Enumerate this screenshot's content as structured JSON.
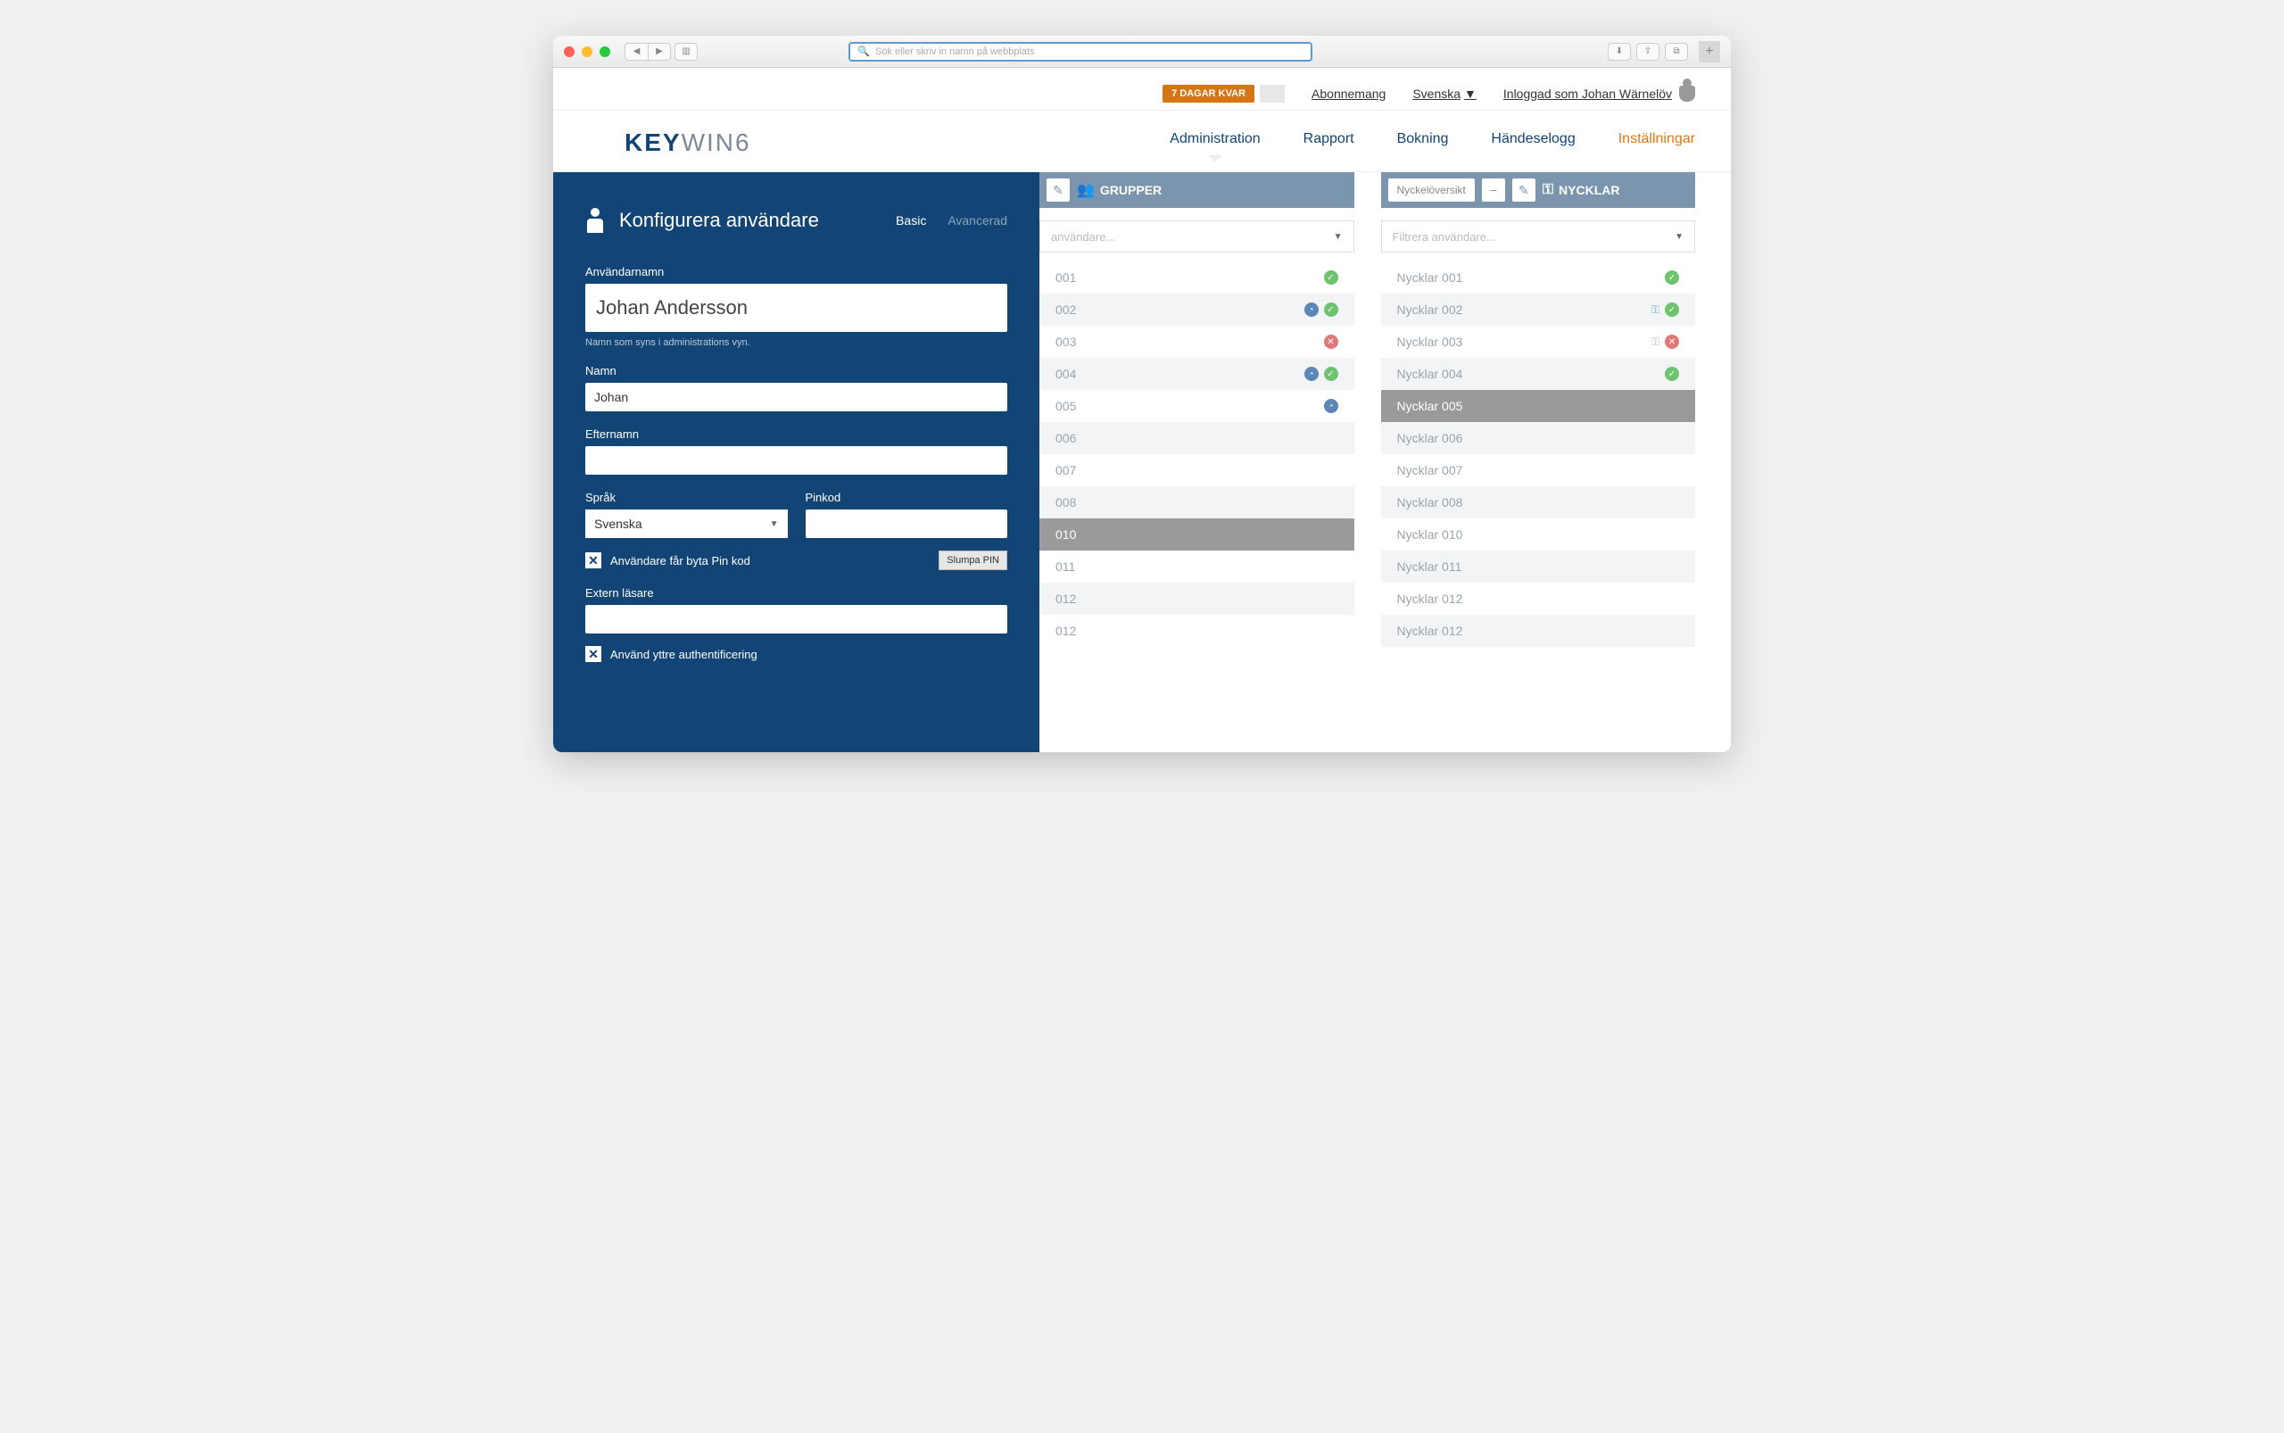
{
  "browser": {
    "placeholder": "Sök eller skriv in namn på webbplats"
  },
  "topstrip": {
    "trial": "7 DAGAR KVAR",
    "subscription": "Abonnemang",
    "language": "Svenska",
    "loggedin": "Inloggad som Johan Wärnelöv"
  },
  "logo": {
    "part1": "KEY",
    "part2": "WIN6"
  },
  "nav": {
    "items": [
      "Administration",
      "Rapport",
      "Bokning",
      "Händeselogg",
      "Inställningar"
    ]
  },
  "drawer": {
    "title": "Konfigurera användare",
    "tab_basic": "Basic",
    "tab_adv": "Avancerad",
    "labels": {
      "username": "Användarnamn",
      "username_hint": "Namn som syns i administrations vyn.",
      "firstname": "Namn",
      "lastname": "Efternamn",
      "language": "Språk",
      "pin": "Pinkod",
      "chk_pin": "Användare får byta Pin kod",
      "slump": "Slumpa PIN",
      "extreader": "Extern läsare",
      "chk_ext": "Använd yttre authentificering"
    },
    "values": {
      "username": "Johan Andersson",
      "firstname": "Johan",
      "lastname": "",
      "language": "Svenska",
      "pin": "",
      "extreader": ""
    }
  },
  "columns": {
    "groups": {
      "title": "GRUPPER",
      "filter": "användare...",
      "rows": [
        {
          "label": "001",
          "icons": [
            "green"
          ],
          "alt": false
        },
        {
          "label": "002",
          "icons": [
            "clock",
            "green"
          ],
          "alt": true
        },
        {
          "label": "003",
          "icons": [
            "red"
          ],
          "alt": false
        },
        {
          "label": "004",
          "icons": [
            "clock",
            "green"
          ],
          "alt": true
        },
        {
          "label": "005",
          "icons": [
            "clock"
          ],
          "alt": false
        },
        {
          "label": "006",
          "icons": [],
          "alt": true
        },
        {
          "label": "007",
          "icons": [],
          "alt": false
        },
        {
          "label": "008",
          "icons": [],
          "alt": true
        },
        {
          "label": "010",
          "icons": [],
          "sel": true
        },
        {
          "label": "011",
          "icons": [],
          "alt": false
        },
        {
          "label": "012",
          "icons": [],
          "alt": true
        },
        {
          "label": "012",
          "icons": [],
          "alt": false
        }
      ]
    },
    "keys": {
      "title": "NYCKLAR",
      "overview": "Nyckelöversikt",
      "filter": "Filtrera användare...",
      "rows": [
        {
          "label": "Nycklar 001",
          "icons": [
            "green"
          ],
          "alt": false
        },
        {
          "label": "Nycklar 002",
          "icons": [
            "key",
            "green"
          ],
          "alt": true
        },
        {
          "label": "Nycklar 003",
          "icons": [
            "keygrey",
            "red"
          ],
          "alt": false
        },
        {
          "label": "Nycklar 004",
          "icons": [
            "green"
          ],
          "alt": true
        },
        {
          "label": "Nycklar 005",
          "icons": [],
          "sel": true
        },
        {
          "label": "Nycklar 006",
          "icons": [],
          "alt": true
        },
        {
          "label": "Nycklar 007",
          "icons": [],
          "alt": false
        },
        {
          "label": "Nycklar 008",
          "icons": [],
          "alt": true
        },
        {
          "label": "Nycklar 010",
          "icons": [],
          "alt": false
        },
        {
          "label": "Nycklar 011",
          "icons": [],
          "alt": true
        },
        {
          "label": "Nycklar 012",
          "icons": [],
          "alt": false
        },
        {
          "label": "Nycklar 012",
          "icons": [],
          "alt": true
        }
      ]
    }
  }
}
